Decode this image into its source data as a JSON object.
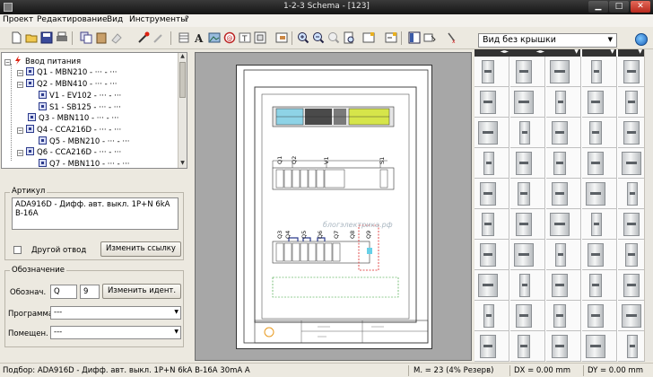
{
  "window": {
    "title": "1-2-3 Schema - [123]"
  },
  "menu": [
    "Проект",
    "Редактирование",
    "Вид",
    "Инструменты",
    "?"
  ],
  "toolbar": {
    "icons": [
      "new-icon",
      "open-icon",
      "save-icon",
      "print-icon",
      "copy-icon",
      "paste-icon",
      "erase-icon",
      "add-device-icon",
      "remove-device-icon",
      "table-icon",
      "text-icon",
      "image-icon",
      "symbol-icon",
      "label-icon",
      "frame-icon",
      "zoom-in-icon",
      "zoom-out-icon",
      "zoom-fit-icon",
      "zoom-page-icon",
      "add-sheet-icon",
      "insert-icon",
      "layout-icon",
      "settings-icon",
      "delete-icon"
    ],
    "view_select": "Вид без крышки"
  },
  "tree": {
    "root": "Ввод питания",
    "items": [
      "Q1 - MBN210 - ··· - ···",
      "Q2 - MBN410 - ··· - ···",
      "V1 - EV102 - ··· - ···",
      "S1 - SB125 - ··· - ···",
      "Q3 - MBN110 - ··· - ···",
      "Q4 - CCA216D - ··· - ···",
      "Q5 - MBN210 - ··· - ···",
      "Q6 - CCA216D - ··· - ···",
      "Q7 - MBN110 - ··· - ···"
    ]
  },
  "article": {
    "legend": "Артикул",
    "text": "ADA916D - Дифф. авт. выкл.  1P+N 6kA B-16A",
    "other_outlet": "Другой отвод",
    "change_link": "Изменить ссылку"
  },
  "designation": {
    "legend": "Обозначение",
    "label": "Обознач.",
    "letter": "Q",
    "number": "9",
    "change_ident": "Изменить идент.",
    "program_label": "Программа",
    "program_value": "---",
    "room_label": "Помещен.",
    "room_value": "---"
  },
  "drawing": {
    "watermark": "блогэлектрика.рф",
    "row1_labels": [
      "Q1",
      "Q2",
      "V1",
      "S1"
    ],
    "row2_labels": [
      "Q3",
      "Q4",
      "Q5",
      "Q6",
      "Q7",
      "Q8",
      "Q9"
    ]
  },
  "status": {
    "selection": "Подбор: ADA916D - Дифф. авт. выкл. 1P+N 6kA B-16A 30mA A",
    "modules": "M. = 23 (4% Резерв)",
    "dx": "DX = 0.00 mm",
    "dy": "DY = 0.00 mm"
  }
}
